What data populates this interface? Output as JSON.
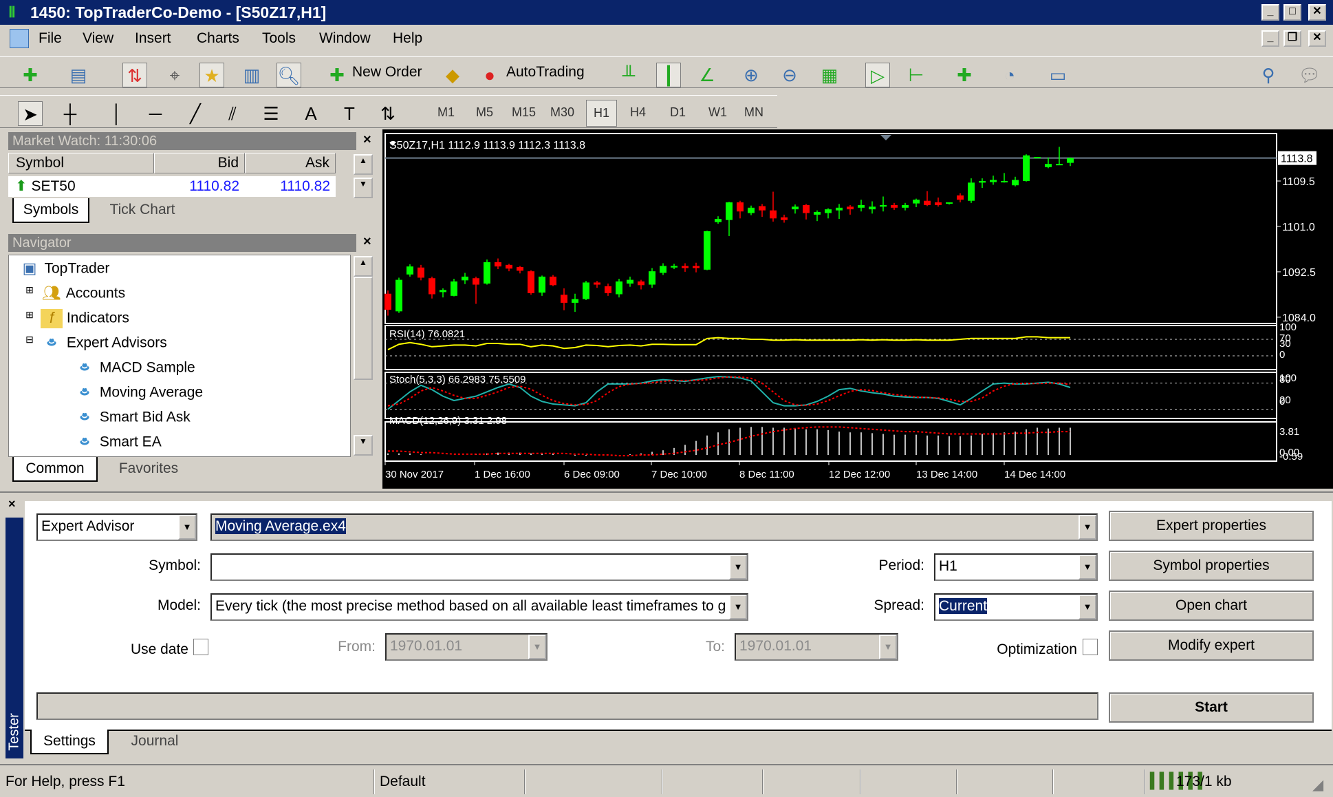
{
  "window": {
    "title": "1450: TopTraderCo-Demo - [S50Z17,H1]"
  },
  "menu": [
    "File",
    "View",
    "Insert",
    "Charts",
    "Tools",
    "Window",
    "Help"
  ],
  "toolbar": {
    "new_order": "New Order",
    "autotrading": "AutoTrading",
    "timeframes": [
      "M1",
      "M5",
      "M15",
      "M30",
      "H1",
      "H4",
      "D1",
      "W1",
      "MN"
    ],
    "active_timeframe": "H1"
  },
  "market_watch": {
    "title": "Market Watch: 11:30:06",
    "columns": [
      "Symbol",
      "Bid",
      "Ask"
    ],
    "rows": [
      {
        "symbol": "SET50",
        "bid": "1110.82",
        "ask": "1110.82",
        "direction": "up"
      }
    ],
    "tabs": [
      "Symbols",
      "Tick Chart"
    ],
    "active_tab": "Symbols"
  },
  "navigator": {
    "title": "Navigator",
    "root": "TopTrader",
    "items": [
      {
        "label": "Accounts",
        "expanded": false
      },
      {
        "label": "Indicators",
        "expanded": false
      },
      {
        "label": "Expert Advisors",
        "expanded": true
      }
    ],
    "experts": [
      "MACD Sample",
      "Moving Average",
      "Smart Bid Ask",
      "Smart EA"
    ],
    "tabs": [
      "Common",
      "Favorites"
    ],
    "active_tab": "Common"
  },
  "chart_data": {
    "type": "candlestick",
    "header": "S50Z17,H1  1112.9 1113.9 1112.3 1113.8",
    "current_price": "1113.8",
    "price_ticks": [
      "1109.5",
      "1101.0",
      "1092.5",
      "1084.0"
    ],
    "ylim": [
      1084.0,
      1113.8
    ],
    "time_ticks": [
      "30 Nov 2017",
      "1 Dec 16:00",
      "6 Dec 09:00",
      "7 Dec 10:00",
      "8 Dec 11:00",
      "12 Dec 12:00",
      "13 Dec 14:00",
      "14 Dec 14:00"
    ],
    "colors": {
      "bull": "#00ff00",
      "bear": "#ff0000",
      "background": "#000000",
      "rsi": "#ffff00",
      "stoch_main": "#20b2aa",
      "stoch_signal": "#ff0000",
      "macd_hist": "#c0c0c0",
      "macd_signal": "#ff0000"
    },
    "ohlc": [
      [
        1088.4,
        1089.0,
        1084.3,
        1085.4
      ],
      [
        1085.1,
        1091.4,
        1084.8,
        1091.0
      ],
      [
        1092.0,
        1093.9,
        1091.6,
        1093.5
      ],
      [
        1093.3,
        1093.8,
        1090.9,
        1091.4
      ],
      [
        1091.3,
        1091.6,
        1087.5,
        1088.3
      ],
      [
        1088.7,
        1089.4,
        1087.7,
        1089.1
      ],
      [
        1088.0,
        1091.2,
        1087.9,
        1090.7
      ],
      [
        1090.9,
        1092.3,
        1090.2,
        1091.6
      ],
      [
        1091.3,
        1091.6,
        1086.5,
        1090.1
      ],
      [
        1090.3,
        1094.8,
        1090.1,
        1094.3
      ],
      [
        1094.3,
        1095.0,
        1093.0,
        1093.5
      ],
      [
        1093.8,
        1094.0,
        1092.6,
        1093.1
      ],
      [
        1093.4,
        1093.6,
        1092.2,
        1092.7
      ],
      [
        1092.6,
        1092.8,
        1088.2,
        1088.5
      ],
      [
        1088.6,
        1091.8,
        1088.0,
        1091.6
      ],
      [
        1091.6,
        1091.9,
        1089.8,
        1090.0
      ],
      [
        1088.2,
        1089.4,
        1085.3,
        1086.7
      ],
      [
        1086.7,
        1088.4,
        1085.0,
        1087.4
      ],
      [
        1087.4,
        1090.8,
        1087.2,
        1090.5
      ],
      [
        1090.5,
        1090.8,
        1089.5,
        1090.1
      ],
      [
        1089.8,
        1090.3,
        1088.0,
        1088.5
      ],
      [
        1088.3,
        1091.2,
        1087.7,
        1090.7
      ],
      [
        1090.3,
        1091.6,
        1089.7,
        1091.0
      ],
      [
        1090.7,
        1091.0,
        1089.2,
        1090.0
      ],
      [
        1090.1,
        1093.2,
        1089.5,
        1092.6
      ],
      [
        1092.3,
        1094.1,
        1091.9,
        1093.6
      ],
      [
        1093.3,
        1094.0,
        1093.0,
        1093.6
      ],
      [
        1093.6,
        1094.1,
        1092.5,
        1093.2
      ],
      [
        1093.6,
        1094.2,
        1092.4,
        1093.2
      ],
      [
        1092.9,
        1100.2,
        1092.8,
        1100.1
      ],
      [
        1101.8,
        1102.9,
        1101.5,
        1102.4
      ],
      [
        1102.2,
        1105.6,
        1099.2,
        1105.5
      ],
      [
        1105.5,
        1105.8,
        1102.5,
        1103.8
      ],
      [
        1103.5,
        1104.9,
        1103.1,
        1104.5
      ],
      [
        1104.8,
        1105.2,
        1102.8,
        1104.0
      ],
      [
        1104.0,
        1107.5,
        1101.9,
        1102.5
      ],
      [
        1102.7,
        1103.2,
        1101.7,
        1102.2
      ],
      [
        1104.2,
        1105.1,
        1103.4,
        1104.7
      ],
      [
        1105.0,
        1105.2,
        1102.3,
        1103.5
      ],
      [
        1103.2,
        1104.0,
        1102.0,
        1103.7
      ],
      [
        1103.5,
        1104.4,
        1102.5,
        1104.2
      ],
      [
        1104.0,
        1105.2,
        1102.4,
        1104.5
      ],
      [
        1104.7,
        1105.0,
        1103.2,
        1104.2
      ],
      [
        1104.5,
        1106.0,
        1103.8,
        1105.0
      ],
      [
        1104.2,
        1105.7,
        1103.4,
        1104.7
      ],
      [
        1104.7,
        1106.6,
        1103.8,
        1105.0
      ],
      [
        1105.0,
        1105.4,
        1104.1,
        1104.5
      ],
      [
        1104.5,
        1105.4,
        1104.0,
        1105.0
      ],
      [
        1105.3,
        1106.2,
        1104.6,
        1106.0
      ],
      [
        1105.8,
        1107.6,
        1104.8,
        1105.0
      ],
      [
        1105.5,
        1106.4,
        1104.7,
        1105.0
      ],
      [
        1105.3,
        1105.5,
        1105.1,
        1105.5
      ],
      [
        1106.8,
        1107.2,
        1105.5,
        1106.0
      ],
      [
        1105.8,
        1110.0,
        1105.4,
        1109.2
      ],
      [
        1109.2,
        1110.0,
        1108.2,
        1109.5
      ],
      [
        1109.3,
        1110.5,
        1108.8,
        1109.7
      ],
      [
        1109.3,
        1111.0,
        1109.2,
        1109.5
      ],
      [
        1108.7,
        1110.3,
        1108.5,
        1109.7
      ],
      [
        1109.5,
        1114.5,
        1109.4,
        1114.3
      ],
      [
        1113.9,
        1114.0,
        1113.8,
        1114.0
      ],
      [
        1112.1,
        1113.9,
        1111.9,
        1112.7
      ],
      [
        1112.6,
        1115.9,
        1112.5,
        1112.7
      ],
      [
        1112.9,
        1113.9,
        1112.3,
        1113.8
      ]
    ],
    "rsi": {
      "label": "RSI(14) 76.0821",
      "levels": [
        "100",
        "70",
        "30",
        "0"
      ],
      "values": [
        45,
        58,
        62,
        58,
        52,
        54,
        56,
        56,
        54,
        60,
        60,
        58,
        58,
        52,
        56,
        54,
        48,
        50,
        56,
        55,
        52,
        55,
        56,
        54,
        58,
        58,
        57,
        57,
        57,
        72,
        74,
        72,
        72,
        70,
        70,
        68,
        68,
        69,
        68,
        68,
        68,
        68,
        68,
        69,
        68,
        69,
        68,
        68,
        69,
        68,
        68,
        68,
        70,
        72,
        72,
        72,
        72,
        72,
        76,
        76,
        74,
        74,
        74
      ]
    },
    "stoch": {
      "label": "Stoch(5,3,3) 66.2983 75.5509",
      "levels": [
        "100",
        "80",
        "20",
        "0"
      ],
      "main": [
        20,
        40,
        60,
        75,
        65,
        50,
        40,
        45,
        50,
        60,
        70,
        78,
        70,
        50,
        38,
        32,
        30,
        28,
        35,
        60,
        78,
        78,
        78,
        80,
        85,
        88,
        86,
        84,
        88,
        92,
        95,
        94,
        92,
        85,
        60,
        35,
        28,
        28,
        30,
        38,
        50,
        65,
        68,
        62,
        58,
        55,
        50,
        48,
        47,
        47,
        45,
        38,
        30,
        45,
        62,
        78,
        80,
        78,
        78,
        80,
        82,
        78,
        70
      ],
      "signal": [
        28,
        32,
        45,
        62,
        70,
        62,
        52,
        45,
        45,
        52,
        60,
        70,
        73,
        66,
        52,
        40,
        33,
        30,
        31,
        40,
        58,
        72,
        78,
        79,
        81,
        84,
        86,
        86,
        86,
        88,
        92,
        94,
        94,
        91,
        80,
        60,
        40,
        30,
        29,
        32,
        40,
        51,
        61,
        65,
        63,
        58,
        54,
        51,
        48,
        47,
        46,
        43,
        38,
        38,
        46,
        62,
        73,
        79,
        79,
        79,
        80,
        80,
        77
      ]
    },
    "macd": {
      "label": "MACD(12,26,9) 3.31 2.98",
      "levels": [
        "3.81",
        "0.00",
        "-0.59"
      ],
      "hist": [
        0.2,
        0.2,
        0.2,
        0.1,
        0,
        0,
        0,
        0,
        0.1,
        0.2,
        0.3,
        0.3,
        0.3,
        0.2,
        0.2,
        0.2,
        0,
        -0.1,
        -0.1,
        0,
        0,
        0,
        0.1,
        0.2,
        0.4,
        0.6,
        0.9,
        1.3,
        1.8,
        2.5,
        2.9,
        3.3,
        3.5,
        3.6,
        3.6,
        3.5,
        3.5,
        3.4,
        3.3,
        3.3,
        3.2,
        3.0,
        2.9,
        2.9,
        2.8,
        2.7,
        2.6,
        2.6,
        2.6,
        2.5,
        2.5,
        2.4,
        2.4,
        2.5,
        2.7,
        2.8,
        2.9,
        3.0,
        3.3,
        3.5,
        3.4,
        3.5,
        3.5
      ],
      "signal": [
        0.5,
        0.5,
        0.4,
        0.3,
        0.3,
        0.2,
        0.1,
        0.1,
        0.1,
        0.1,
        0.2,
        0.2,
        0.2,
        0.2,
        0.2,
        0.2,
        0.2,
        0.1,
        0.1,
        0,
        0,
        -0.1,
        -0.1,
        0,
        0,
        0.1,
        0.2,
        0.4,
        0.6,
        0.9,
        1.3,
        1.6,
        2.0,
        2.4,
        2.7,
        3.0,
        3.2,
        3.4,
        3.5,
        3.6,
        3.6,
        3.6,
        3.5,
        3.4,
        3.3,
        3.2,
        3.1,
        3.0,
        3.0,
        2.9,
        2.8,
        2.7,
        2.7,
        2.7,
        2.7,
        2.7,
        2.7,
        2.8,
        2.8,
        2.9,
        2.9,
        3.0,
        3.0
      ]
    }
  },
  "tester": {
    "side_label": "Tester",
    "type": "Expert Advisor",
    "expert": "Moving Average.ex4",
    "symbol_label": "Symbol:",
    "symbol": "",
    "model_label": "Model:",
    "model": "Every tick (the most precise method based on all available least timeframes to g",
    "period_label": "Period:",
    "period": "H1",
    "spread_label": "Spread:",
    "spread": "Current",
    "use_date_label": "Use date",
    "use_date": false,
    "from_label": "From:",
    "from": "1970.01.01",
    "to_label": "To:",
    "to": "1970.01.01",
    "optimization_label": "Optimization",
    "optimization": false,
    "buttons": {
      "expert_properties": "Expert properties",
      "symbol_properties": "Symbol properties",
      "open_chart": "Open chart",
      "modify_expert": "Modify expert",
      "start": "Start"
    },
    "progress": 0,
    "tabs": [
      "Settings",
      "Journal"
    ],
    "active_tab": "Settings"
  },
  "status": {
    "help": "For Help, press F1",
    "profile": "Default",
    "traffic": "173/1 kb"
  }
}
